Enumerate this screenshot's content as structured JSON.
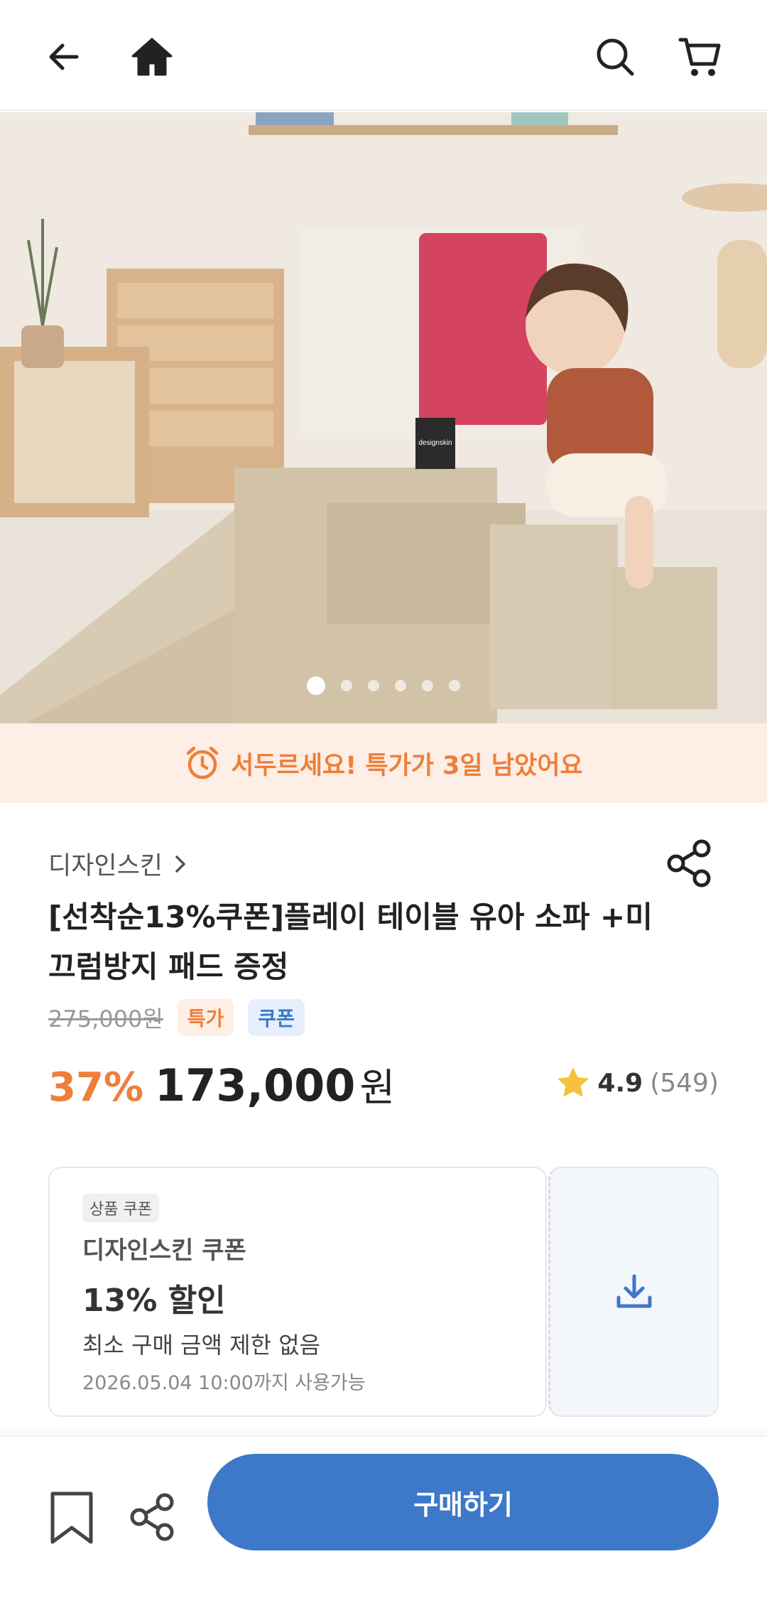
{
  "header": {
    "back_icon": "arrow-left-icon",
    "home_icon": "home-icon",
    "search_icon": "search-icon",
    "cart_icon": "cart-icon"
  },
  "hero": {
    "logo_text": "designskin",
    "carousel": {
      "total": 6,
      "active_index": 1
    }
  },
  "banner": {
    "icon": "alarm-clock-icon",
    "text": "서두르세요! 특가가 3일 남았어요",
    "color": "#ee7f3a",
    "background": "#fdeee6"
  },
  "product": {
    "brand": "디자인스킨",
    "brand_chevron": ">",
    "title": "[선착순13%쿠폰]플레이 테이블 유아 소파 +미끄럼방지 패드 증정",
    "original_price": "275,000원",
    "tags": [
      "특가",
      "쿠폰"
    ],
    "discount": "37%",
    "price": "173,000",
    "currency": "원",
    "rating": "4.9",
    "review_count": "(549)"
  },
  "coupon": {
    "label": "상품 쿠폰",
    "brand": "디자인스킨 쿠폰",
    "discount": "13% 할인",
    "condition": "최소 구매 금액 제한 없음",
    "expiry": "2026.05.04 10:00까지 사용가능",
    "download_icon": "download-icon"
  },
  "bottom_bar": {
    "bookmark_icon": "bookmark-icon",
    "share_icon": "share-icon",
    "buy_label": "구매하기",
    "accent": "#3e78c9"
  }
}
